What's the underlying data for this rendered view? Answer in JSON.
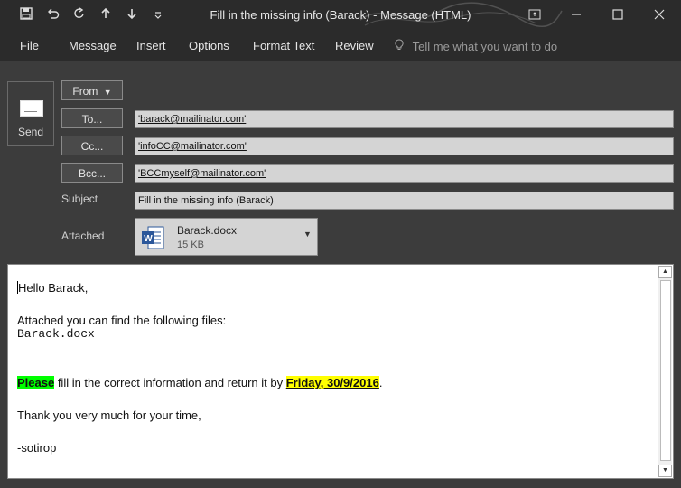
{
  "window": {
    "title": "Fill in the missing info (Barack) - Message (HTML)"
  },
  "quick_access": [
    "save-icon",
    "undo-icon",
    "redo-icon",
    "up-arrow-icon",
    "down-arrow-icon",
    "customize-icon"
  ],
  "ribbon": {
    "tabs": [
      "File",
      "Message",
      "Insert",
      "Options",
      "Format Text",
      "Review"
    ],
    "tell_me": "Tell me what you want to do"
  },
  "header": {
    "send_label": "Send",
    "from_label": "From",
    "to_label": "To...",
    "cc_label": "Cc...",
    "bcc_label": "Bcc...",
    "subject_label": "Subject",
    "attached_label": "Attached",
    "to_value": "'barack@mailinator.com'",
    "cc_value": "'infoCC@mailinator.com'",
    "bcc_value": "'BCCmyself@mailinator.com'",
    "subject_value": "Fill in the missing info (Barack)",
    "attachment": {
      "name": "Barack.docx",
      "size": "15 KB"
    }
  },
  "body": {
    "greeting": "Hello Barack,",
    "line_attached": "Attached you can find the following files:",
    "file_line": "Barack.docx",
    "please": "Please",
    "mid": " fill in the correct information and return it by ",
    "date": "Friday, 30/9/2016",
    "end": ".",
    "thanks": "Thank you very much for your time,",
    "signature": "-sotirop"
  },
  "colors": {
    "titlebar": "#2b2b2b",
    "header_bg": "#3c3c3c",
    "field_bg": "#d4d4d4",
    "highlight_green": "#00ff00",
    "highlight_yellow": "#ffff00",
    "word_blue": "#2b579a"
  }
}
